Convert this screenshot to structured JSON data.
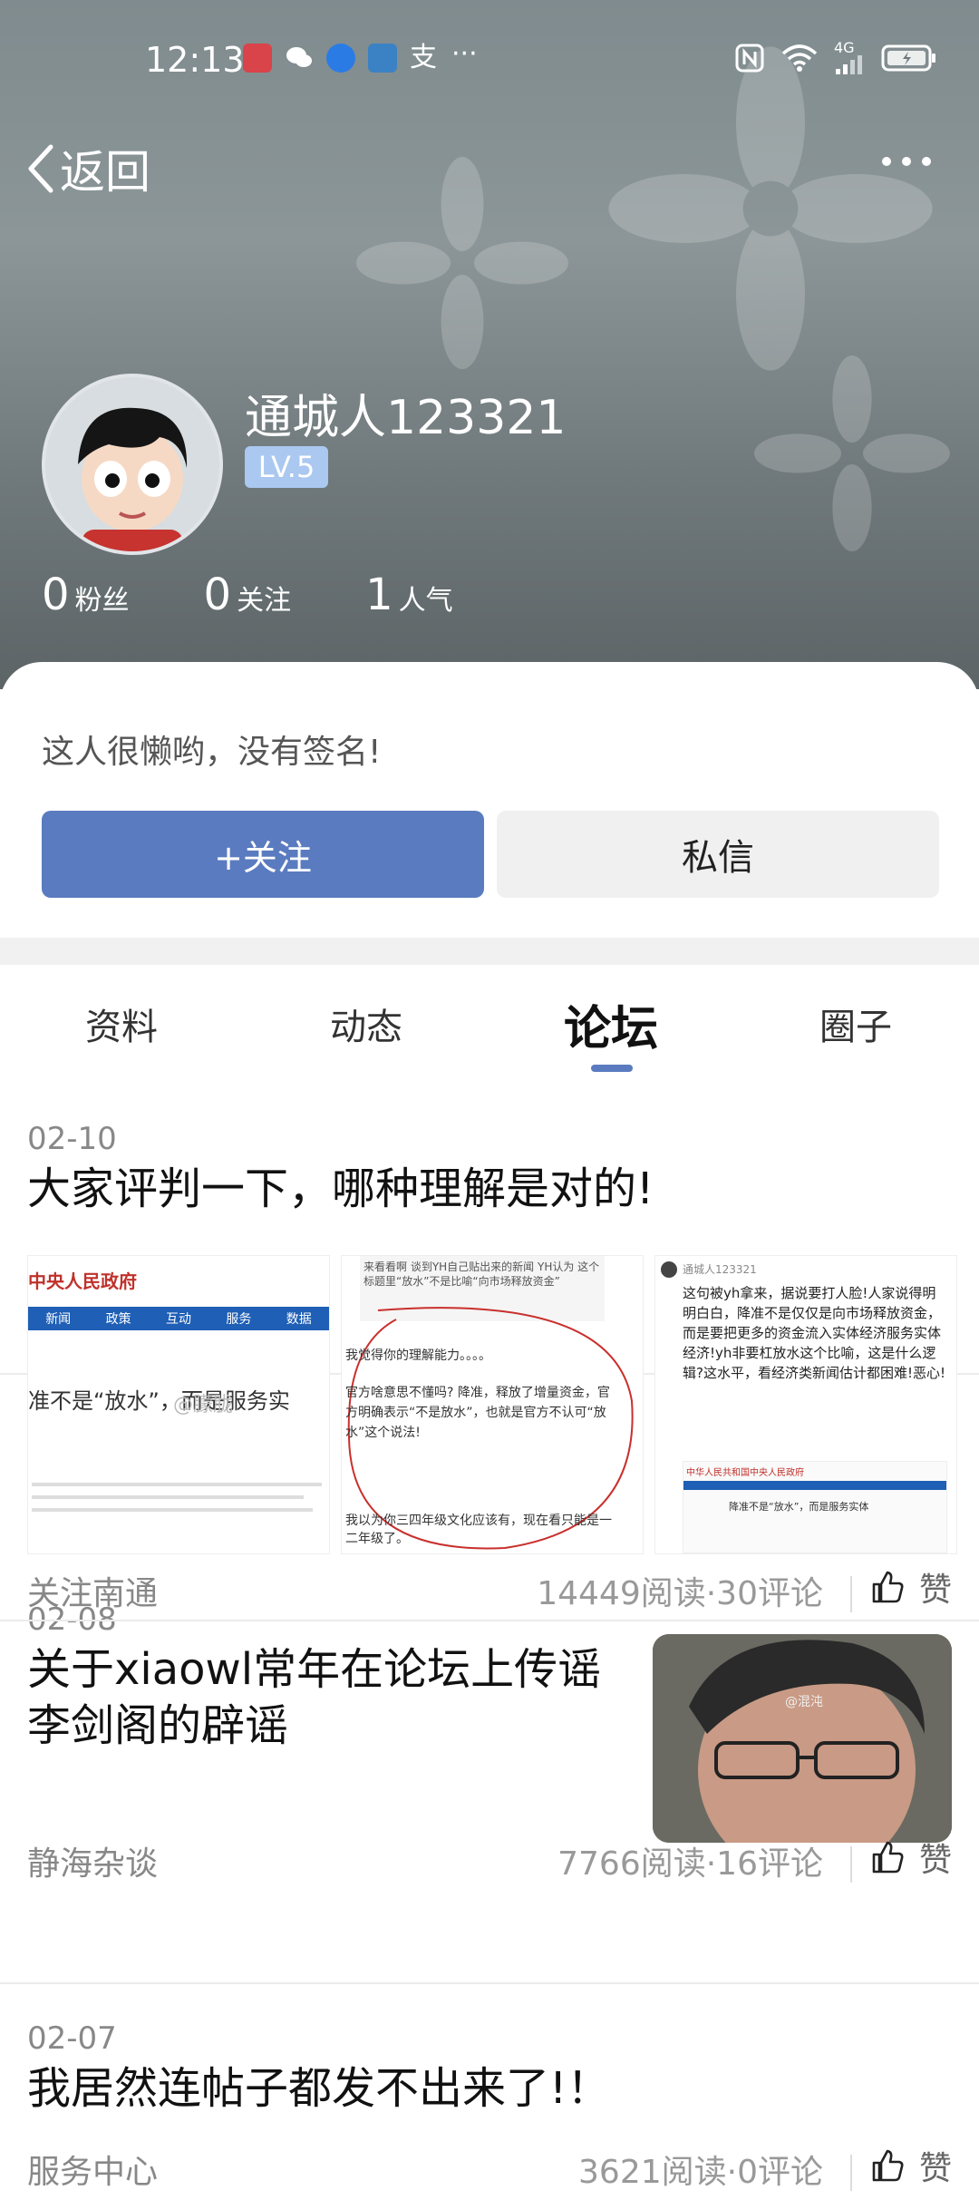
{
  "status_bar": {
    "time": "12:13",
    "network": "4G",
    "notif_icons": [
      "book-app-icon",
      "wechat-icon",
      "browser-icon",
      "game-icon",
      "alipay-icon",
      "more-dots-icon"
    ]
  },
  "nav": {
    "back_label": "返回"
  },
  "profile": {
    "username": "通城人123321",
    "level": "LV.5",
    "stats": [
      {
        "num": "0",
        "label": "粉丝"
      },
      {
        "num": "0",
        "label": "关注"
      },
      {
        "num": "1",
        "label": "人气"
      }
    ],
    "signature": "这人很懒哟，没有签名!"
  },
  "actions": {
    "follow": "+关注",
    "message": "私信"
  },
  "tabs": [
    "资料",
    "动态",
    "论坛",
    "圈子"
  ],
  "active_tab": "论坛",
  "colors": {
    "accent": "#5a7bbf",
    "level_badge": "#aac8f0"
  },
  "posts": [
    {
      "date": "02-10",
      "title": "大家评判一下，哪种理解是对的!",
      "source": "关注南通",
      "stats": "14449阅读·30评论",
      "like": "赞",
      "thumbs": {
        "t1": {
          "header": "中央人民政府",
          "nav": [
            "新闻",
            "政策",
            "互动",
            "服务",
            "数据"
          ],
          "headline": "准不是“放水”，而是服务实",
          "watermark": "@朦胧"
        },
        "t2": {
          "top": "来看看啊 谈到YH自己贴出来的新闻 YH认为 这个标题里“放水”不是比喻“向市场释放资金”",
          "l1": "我觉得你的理解能力。。。。",
          "l2": "官方啥意思不懂吗? 降准，释放了增量资金，官方明确表示“不是放水”，也就是官方不认可“放水”这个说法!",
          "l3": "我以为你三四年级文化应该有，现在看只能是一二年级了。"
        },
        "t3": {
          "user": "通城人123321",
          "text": "这句被yh拿来，据说要打人脸!人家说得明明白白，降准不是仅仅是向市场释放资金，而是要把更多的资金流入实体经济服务实体经济!yh非要杠放水这个比喻，这是什么逻辑?这水平，看经济类新闻估计都困难!恶心!",
          "mini_header": "中华人民共和国中央人民政府",
          "mini_headline": "降准不是“放水”，而是服务实体"
        }
      }
    },
    {
      "date": "02-08",
      "title": "关于xiaowl常年在论坛上传谣李剑阁的辟谣",
      "source": "静海杂谈",
      "stats": "7766阅读·16评论",
      "like": "赞",
      "photo_watermark": "@混沌"
    },
    {
      "date": "02-07",
      "title": "我居然连帖子都发不出来了!！",
      "source": "服务中心",
      "stats": "3621阅读·0评论",
      "like": "赞"
    }
  ]
}
